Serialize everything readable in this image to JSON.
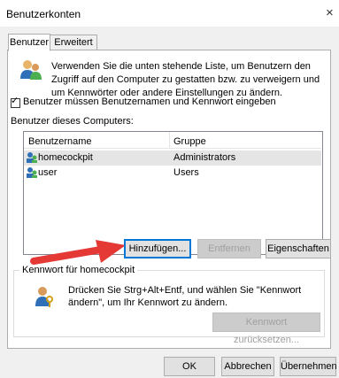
{
  "window": {
    "title": "Benutzerkonten",
    "close_glyph": "×"
  },
  "tabs": [
    {
      "label": "Benutzer",
      "active": true
    },
    {
      "label": "Erweitert",
      "active": false
    }
  ],
  "intro": {
    "icon": "users-icon",
    "text": "Verwenden Sie die unten stehende Liste, um Benutzern den Zugriff auf den Computer zu gestatten bzw. zu verweigern und um Kennwörter oder andere Einstellungen zu ändern."
  },
  "checkbox": {
    "label": "Benutzer müssen Benutzernamen und Kennwort eingeben",
    "checked": true
  },
  "users_section": {
    "label": "Benutzer dieses Computers:",
    "columns": [
      "Benutzername",
      "Gruppe"
    ],
    "rows": [
      {
        "name": "homecockpit",
        "group": "Administrators",
        "selected": true
      },
      {
        "name": "user",
        "group": "Users",
        "selected": false
      }
    ]
  },
  "buttons": {
    "add": "Hinzufügen...",
    "remove": "Entfernen",
    "properties": "Eigenschaften"
  },
  "password_group": {
    "title": "Kennwort für homecockpit",
    "icon": "key-user-icon",
    "text": "Drücken Sie Strg+Alt+Entf, und wählen Sie \"Kennwort ändern\", um Ihr Kennwort zu ändern.",
    "reset_button": "Kennwort zurücksetzen..."
  },
  "footer": {
    "ok": "OK",
    "cancel": "Abbrechen",
    "apply": "Übernehmen"
  },
  "colors": {
    "arrow": "#e53935",
    "selection": "#e5e5e5",
    "focus": "#0078d7"
  }
}
